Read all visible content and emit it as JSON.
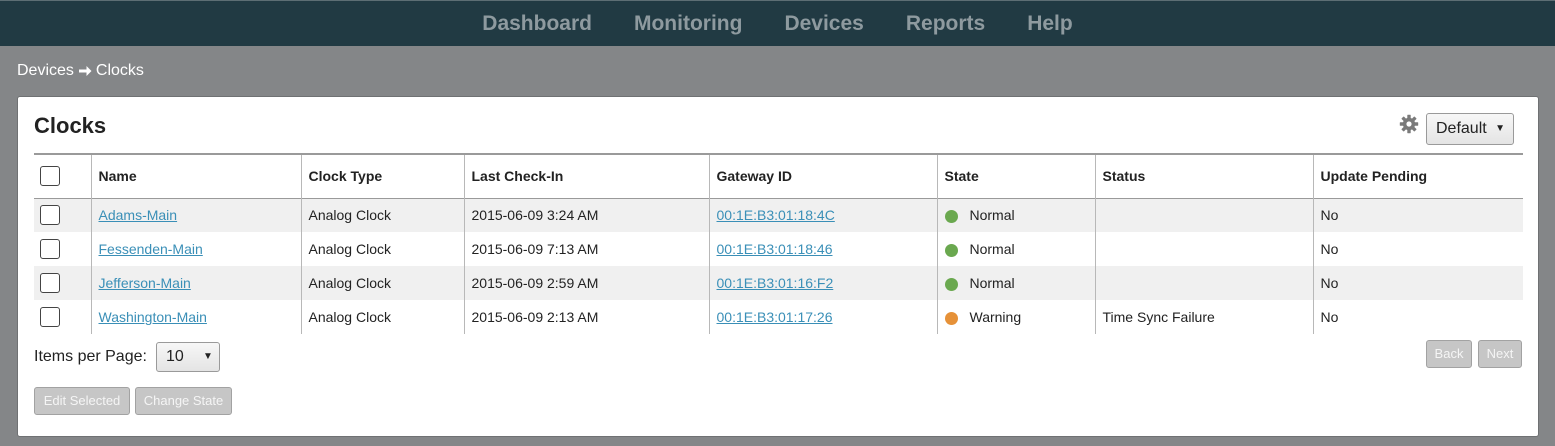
{
  "nav": {
    "items": [
      {
        "label": "Dashboard"
      },
      {
        "label": "Monitoring"
      },
      {
        "label": "Devices"
      },
      {
        "label": "Reports"
      },
      {
        "label": "Help"
      }
    ]
  },
  "breadcrumb": {
    "parent": "Devices",
    "current": "Clocks"
  },
  "panel": {
    "title": "Clocks",
    "view_select": "Default",
    "icons": {
      "settings": "gear-icon",
      "separator": "arrow-right-icon"
    }
  },
  "table": {
    "columns": [
      "Name",
      "Clock Type",
      "Last Check-In",
      "Gateway ID",
      "State",
      "Status",
      "Update Pending"
    ],
    "rows": [
      {
        "name": "Adams-Main",
        "clock_type": "Analog Clock",
        "last_checkin": "2015-06-09 3:24 AM",
        "gateway_id": "00:1E:B3:01:18:4C",
        "state": "Normal",
        "state_color": "#6aa84f",
        "status": "",
        "update_pending": "No"
      },
      {
        "name": "Fessenden-Main",
        "clock_type": "Analog Clock",
        "last_checkin": "2015-06-09 7:13 AM",
        "gateway_id": "00:1E:B3:01:18:46",
        "state": "Normal",
        "state_color": "#6aa84f",
        "status": "",
        "update_pending": "No"
      },
      {
        "name": "Jefferson-Main",
        "clock_type": "Analog Clock",
        "last_checkin": "2015-06-09 2:59 AM",
        "gateway_id": "00:1E:B3:01:16:F2",
        "state": "Normal",
        "state_color": "#6aa84f",
        "status": "",
        "update_pending": "No"
      },
      {
        "name": "Washington-Main",
        "clock_type": "Analog Clock",
        "last_checkin": "2015-06-09 2:13 AM",
        "gateway_id": "00:1E:B3:01:17:26",
        "state": "Warning",
        "state_color": "#e69138",
        "status": "Time Sync Failure",
        "update_pending": "No"
      }
    ]
  },
  "pagination": {
    "items_per_page_label": "Items per Page:",
    "items_per_page_value": "10",
    "back_label": "Back",
    "next_label": "Next"
  },
  "actions": {
    "edit_selected_label": "Edit Selected",
    "change_state_label": "Change State"
  }
}
